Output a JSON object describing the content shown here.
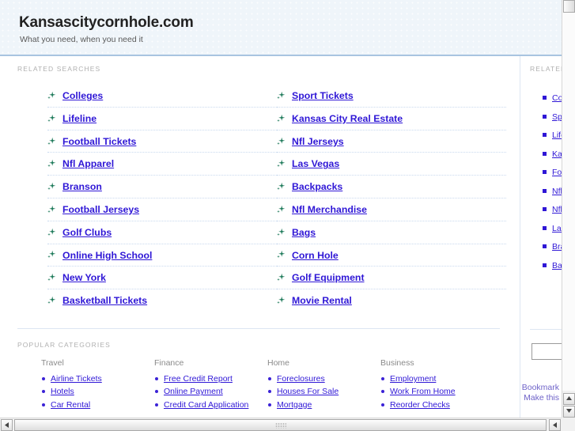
{
  "header": {
    "title": "Kansascitycornhole.com",
    "tagline": "What you need, when you need it"
  },
  "main": {
    "related_label": "RELATED SEARCHES",
    "popular_label": "POPULAR CATEGORIES",
    "related_left": [
      {
        "label": "Colleges"
      },
      {
        "label": "Lifeline"
      },
      {
        "label": "Football Tickets"
      },
      {
        "label": "Nfl Apparel"
      },
      {
        "label": "Branson"
      },
      {
        "label": "Football Jerseys"
      },
      {
        "label": "Golf Clubs"
      },
      {
        "label": "Online High School"
      },
      {
        "label": "New York"
      },
      {
        "label": "Basketball Tickets"
      }
    ],
    "related_right": [
      {
        "label": "Sport Tickets"
      },
      {
        "label": "Kansas City Real Estate"
      },
      {
        "label": "Nfl Jerseys"
      },
      {
        "label": "Las Vegas"
      },
      {
        "label": "Backpacks"
      },
      {
        "label": "Nfl Merchandise"
      },
      {
        "label": "Bags"
      },
      {
        "label": "Corn Hole"
      },
      {
        "label": "Golf Equipment"
      },
      {
        "label": "Movie Rental"
      }
    ],
    "categories": [
      {
        "title": "Travel",
        "items": [
          "Airline Tickets",
          "Hotels",
          "Car Rental"
        ]
      },
      {
        "title": "Finance",
        "items": [
          "Free Credit Report",
          "Online Payment",
          "Credit Card Application"
        ]
      },
      {
        "title": "Home",
        "items": [
          "Foreclosures",
          "Houses For Sale",
          "Mortgage"
        ]
      },
      {
        "title": "Business",
        "items": [
          "Employment",
          "Work From Home",
          "Reorder Checks"
        ]
      }
    ]
  },
  "sidebar": {
    "label": "RELATED",
    "items": [
      {
        "label": "Colleges"
      },
      {
        "label": "Sport Tickets"
      },
      {
        "label": "Lifeline"
      },
      {
        "label": "Kansas City Real Estate"
      },
      {
        "label": "Football Tickets"
      },
      {
        "label": "Nfl Jerseys"
      },
      {
        "label": "Nfl Apparel"
      },
      {
        "label": "Las Vegas"
      },
      {
        "label": "Branson"
      },
      {
        "label": "Backpacks"
      }
    ],
    "search_value": "",
    "search_placeholder": "",
    "footer_links": [
      "Bookmark",
      "Make this"
    ]
  },
  "colors": {
    "link": "#2f17d6",
    "header_bg": "#eff5fa",
    "header_border": "#a8c4e0",
    "bullet_green": "#1e7a5a",
    "label_gray": "#b0b0b0"
  }
}
